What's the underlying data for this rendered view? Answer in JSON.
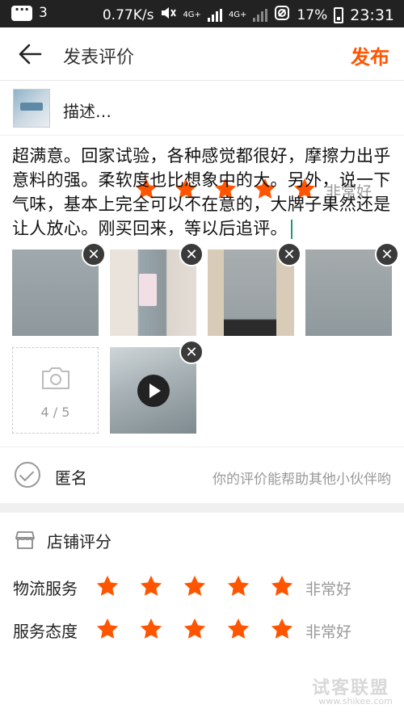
{
  "status_bar": {
    "notification_count": "3",
    "net_speed": "0.77K/s",
    "net_1": "4G+",
    "net_2": "4G+",
    "battery": "17%",
    "time": "23:31"
  },
  "header": {
    "title": "发表评价",
    "publish_label": "发布"
  },
  "product": {
    "label": "描述…",
    "rating_count": 5,
    "rating_text": "非常好"
  },
  "review": {
    "text": "超满意。回家试验，各种感觉都很好，摩擦力出乎意料的强。柔软度也比想象中的大。另外，说一下气味，基本上完全可以不在意的，大牌子果然还是让人放心。刚买回来，等以后追评。"
  },
  "photos": {
    "remove_glyph": "✕",
    "add_count": "4 / 5"
  },
  "anonymous": {
    "label": "匿名",
    "hint": "你的评价能帮助其他小伙伴哟"
  },
  "store": {
    "title": "店铺评分",
    "logistics_label": "物流服务",
    "logistics_rating": 5,
    "logistics_text": "非常好",
    "service_label": "服务态度",
    "service_rating": 5,
    "service_text": "非常好"
  },
  "watermark": {
    "text": "试客联盟",
    "url": "www.shikee.com"
  },
  "colors": {
    "accent": "#ff5500",
    "star": "#ff5500"
  }
}
